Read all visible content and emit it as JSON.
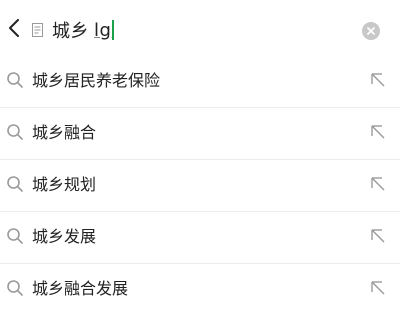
{
  "search": {
    "typed_text": "城乡",
    "ime_text": "lg"
  },
  "suggestions": [
    {
      "label": "城乡居民养老保险"
    },
    {
      "label": "城乡融合"
    },
    {
      "label": "城乡规划"
    },
    {
      "label": "城乡发展"
    },
    {
      "label": "城乡融合发展"
    }
  ],
  "colors": {
    "caret": "#1aa14a",
    "text": "#222222",
    "divider": "#ececec",
    "icon_gray": "#9a9a9a"
  }
}
